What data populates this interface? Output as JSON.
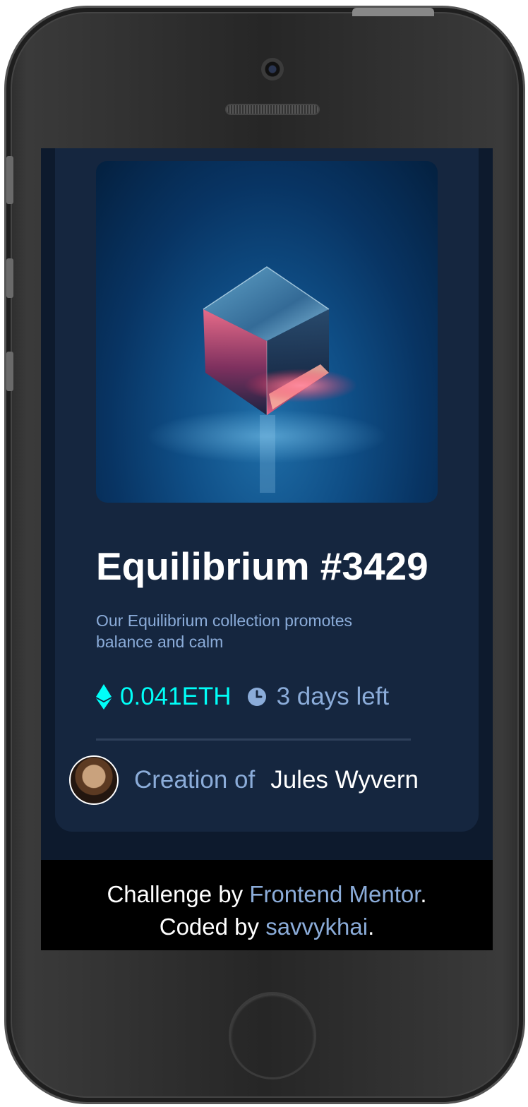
{
  "nft": {
    "title": "Equilibrium #3429",
    "description": "Our Equilibrium collection promotes balance and calm",
    "price": "0.041ETH",
    "time_left": "3 days left"
  },
  "creator": {
    "prefix": "Creation of",
    "name": "Jules Wyvern"
  },
  "attribution": {
    "challenge_prefix": "Challenge by",
    "challenge_link": "Frontend Mentor",
    "challenge_suffix": ".",
    "coded_prefix": "Coded by",
    "coded_link": "savvykhai",
    "coded_suffix": "."
  },
  "colors": {
    "background": "#0d1a2d",
    "card": "#15263f",
    "cyan": "#00fff8",
    "soft_blue": "#8bacd9",
    "white": "#ffffff"
  },
  "icons": [
    "ethereum-icon",
    "clock-icon"
  ]
}
